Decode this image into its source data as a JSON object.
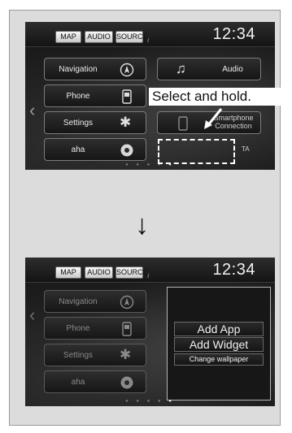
{
  "screen1": {
    "topbar": {
      "buttons": [
        "MAP",
        "AUDIO",
        "SOURCE"
      ],
      "clock": "12:34"
    },
    "tiles": [
      {
        "label": "Navigation",
        "icon": "compass-icon"
      },
      {
        "label": "Phone",
        "icon": "phone-icon"
      },
      {
        "label": "Settings",
        "icon": "gear-icon"
      },
      {
        "label": "aha",
        "icon": "aha-icon"
      },
      {
        "label": "Audio",
        "icon": "music-note-icon"
      },
      {
        "label": "Smartphone Connection",
        "label_line1": "Smartphone",
        "label_line2": "Connection",
        "icon": "smartphone-icon"
      },
      {
        "label": "TA"
      }
    ],
    "callout": "Select and hold."
  },
  "screen2": {
    "topbar": {
      "buttons": [
        "MAP",
        "AUDIO",
        "SOURCE"
      ],
      "clock": "12:34"
    },
    "tiles": [
      {
        "label": "Navigation"
      },
      {
        "label": "Phone"
      },
      {
        "label": "Settings"
      },
      {
        "label": "aha"
      }
    ],
    "menu": {
      "items": [
        "Add App",
        "Add Widget",
        "Change wallpaper"
      ]
    }
  },
  "colors": {
    "background": "#dcdcdc",
    "screen": "#1b1b1b",
    "text_light": "#ececec"
  }
}
